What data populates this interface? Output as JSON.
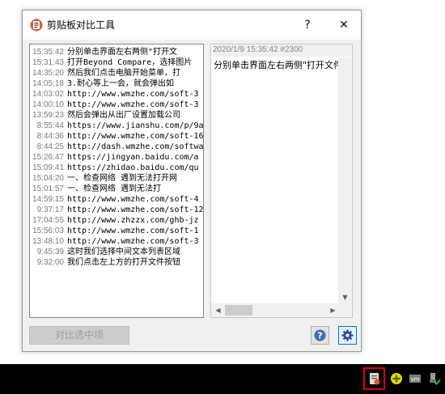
{
  "window": {
    "title": "剪贴板对比工具",
    "help_glyph": "?",
    "close_glyph": "✕"
  },
  "history": [
    {
      "time": "15:35:42",
      "text": "分别单击界面左右两侧\"打开文"
    },
    {
      "time": "15:31:43",
      "text": "打开Beyond Compare，选择图片"
    },
    {
      "time": "14:35:20",
      "text": "然后我们点击电脑开始菜单，打"
    },
    {
      "time": "14:05:18",
      "text": "3.耐心等上一会，就会弹出如"
    },
    {
      "time": "14:03:02",
      "text": "http://www.wmzhe.com/soft-3"
    },
    {
      "time": "14:00:10",
      "text": "http://www.wmzhe.com/soft-3"
    },
    {
      "time": "13:59:23",
      "text": "然后会弹出从出厂设置加载公司"
    },
    {
      "time": "8:55:44",
      "text": "https://www.jianshu.com/p/9a"
    },
    {
      "time": "8:44:36",
      "text": "http://www.wmzhe.com/soft-16"
    },
    {
      "time": "8:44:25",
      "text": "http://dash.wmzhe.com/softwa"
    },
    {
      "time": "15:26:47",
      "text": "https://jingyan.baidu.com/a"
    },
    {
      "time": "15:09:41",
      "text": "https://zhidao.baidu.com/qu"
    },
    {
      "time": "15:04:20",
      "text": "一、检查网络 遇到无法打开网"
    },
    {
      "time": "15:01:57",
      "text": "一、检查网络       遇到无法打"
    },
    {
      "time": "14:59:15",
      "text": "http://www.wmzhe.com/soft-4"
    },
    {
      "time": "9:37:17",
      "text": "http://www.wmzhe.com/soft-12"
    },
    {
      "time": "17:04:55",
      "text": "http://www.zhzzx.com/ghb-jz"
    },
    {
      "time": "15:56:03",
      "text": "http://www.wmzhe.com/soft-1"
    },
    {
      "time": "13:48:10",
      "text": "http://www.wmzhe.com/soft-3"
    },
    {
      "time": "9:45:39",
      "text": "这时我们选择中间文本列表区域"
    },
    {
      "time": "9:32:00",
      "text": "我们点击左上方的打开文件按钮"
    }
  ],
  "detail": {
    "meta": "2020/1/9 15:35:42 #2300",
    "text": "分别单击界面左右两侧\"打开文件"
  },
  "buttons": {
    "compare_selected": "对比选中项"
  },
  "colors": {
    "highlight_border": "#e00000",
    "taskbar": "#000000"
  }
}
